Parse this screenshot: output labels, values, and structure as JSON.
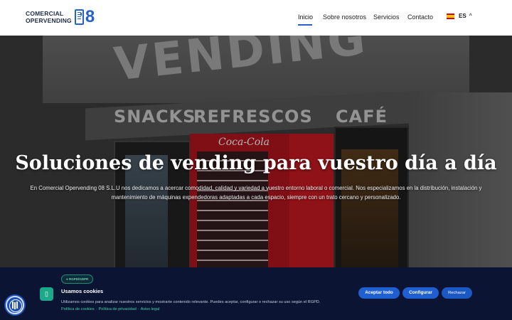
{
  "header": {
    "logo_line1": "COMERCIAL",
    "logo_line2": "OPERVENDING",
    "logo_number": "8",
    "nav": [
      {
        "label": "Inicio",
        "active": true
      },
      {
        "label": "Sobre nosotros",
        "active": false
      },
      {
        "label": "Servicios",
        "active": false
      },
      {
        "label": "Contacto",
        "active": false
      }
    ],
    "language": "ES",
    "language_flag_icon": "spain-flag-icon",
    "accent_color": "#2563c9"
  },
  "hero": {
    "title": "Soluciones de vending para vuestro día a día",
    "subtitle_line1": "En Comercial Opervending 08 S.L.U nos dedicamos a acercar comodidad, calidad y variedad a vuestro entorno laboral o comercial. Nos especializamos en la distribución, instalación y",
    "subtitle_line2": "mantenimiento de máquinas expendedoras adaptadas a cada espacio, siempre con un trato cercano y personalizado."
  },
  "cookie_banner": {
    "badge": "● RGPD/GDPR",
    "title": "Usamos cookies",
    "text": "Utilizamos cookies para analizar nuestros servicios y mostrarte contenido relevante. Puedes aceptar, configurar o rechazar su uso según el RGPD.",
    "link_cookies": "Política de cookies",
    "link_privacy": "Política de privacidad",
    "link_legal": "Aviso legal",
    "separator": "·",
    "accept_label": "Aceptar todo",
    "configure_label": "Configurar",
    "reject_label": "Rechazar",
    "background_color": "#0b1533",
    "button_color": "#1f5fd1"
  },
  "accessibility": {
    "icon": "accessibility-icon"
  }
}
